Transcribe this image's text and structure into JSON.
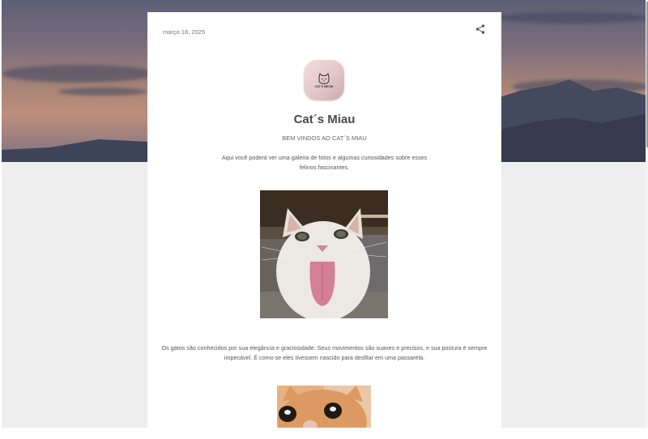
{
  "post": {
    "date": "março 18, 2025",
    "logo_text": "CAT'S MEOW",
    "title": "Cat´s Miau",
    "subtitle": "BEM VINDOS AO CAT´S MIAU",
    "intro": "Aqui você poderá ver uma galeria de fotos e algumas curiosidades sobre esses felinos fascinantes.",
    "paragraph": "Os gatos são conhecidos por sua elegância e graciosidade. Seus movimentos são suaves e precisos, e sua postura é sempre impecável. É como se eles tivessem nascido para desfilar em uma passarela."
  },
  "icons": {
    "share": "share-icon",
    "logo": "cat-face-icon"
  },
  "colors": {
    "page_background": "#eeeeee",
    "card_background": "#ffffff",
    "title_text": "#4a4a4a",
    "logo_gradient_start": "#f3dede",
    "logo_gradient_end": "#cda9ab"
  }
}
